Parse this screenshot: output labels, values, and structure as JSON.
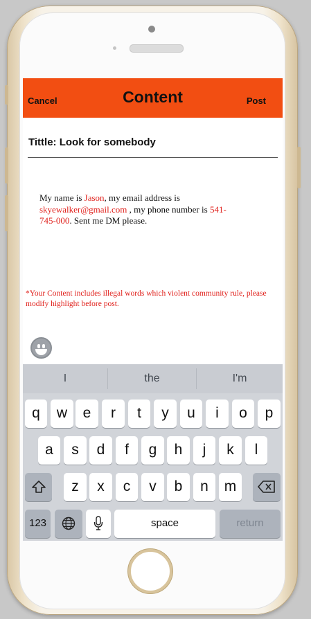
{
  "nav": {
    "cancel": "Cancel",
    "title": "Content",
    "post": "Post"
  },
  "post_title": "Tittle: Look for somebody",
  "content": {
    "t1": "My name is ",
    "name": "Jason",
    "t2": ", my email address is ",
    "email": "skyewalker@gmail.com",
    "t3": " , my phone number is ",
    "phone": "541-745-000",
    "t4": ". Sent me DM please."
  },
  "warning": "*Your Content includes illegal words which violent community rule, please modify highlight before post.",
  "keyboard": {
    "suggestions": [
      "I",
      "the",
      "I'm"
    ],
    "row1": [
      "q",
      "w",
      "e",
      "r",
      "t",
      "y",
      "u",
      "i",
      "o",
      "p"
    ],
    "row2": [
      "a",
      "s",
      "d",
      "f",
      "g",
      "h",
      "j",
      "k",
      "l"
    ],
    "row3": [
      "z",
      "x",
      "c",
      "v",
      "b",
      "n",
      "m"
    ],
    "numbers": "123",
    "space": "space",
    "return": "return"
  },
  "icons": {
    "emoji": "emoji-icon",
    "shift": "shift-icon",
    "backspace": "backspace-icon",
    "globe": "globe-icon",
    "mic": "microphone-icon"
  },
  "colors": {
    "navbar": "#f24e12",
    "highlight": "#e0201b"
  }
}
